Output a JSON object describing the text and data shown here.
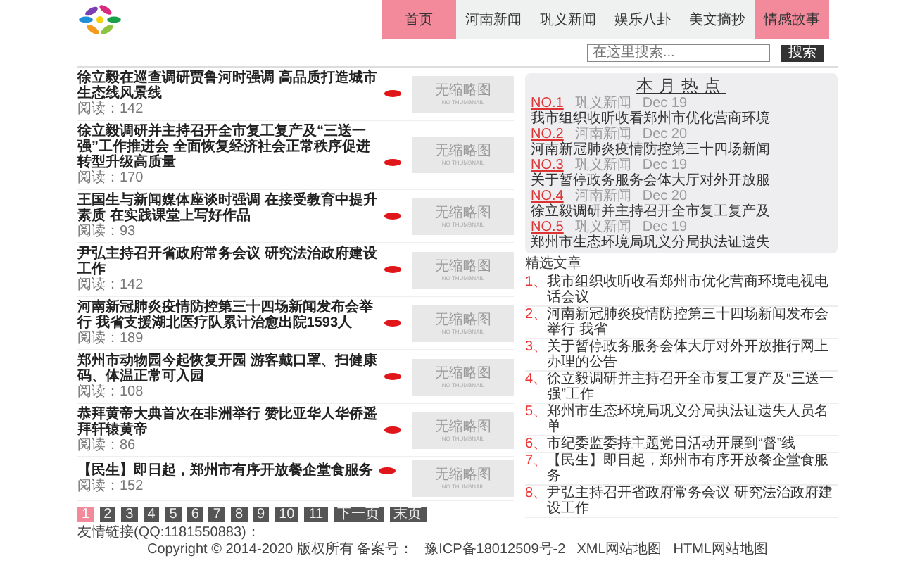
{
  "nav": [
    {
      "label": "首页",
      "selected": true
    },
    {
      "label": "河南新闻",
      "selected": false
    },
    {
      "label": "巩义新闻",
      "selected": false
    },
    {
      "label": "娱乐八卦",
      "selected": false
    },
    {
      "label": "美文摘抄",
      "selected": false
    },
    {
      "label": "情感故事",
      "selected": true
    }
  ],
  "search": {
    "placeholder": "在这里搜索...",
    "button": "搜索"
  },
  "articles": [
    {
      "title": "徐立毅在巡查调研贾鲁河时强调 高品质打造城市生态线风景线",
      "reads": "阅读：142",
      "thumbnail": {
        "text": "无缩略图",
        "subtext": "NO THUMBNAIL"
      }
    },
    {
      "title": "徐立毅调研并主持召开全市复工复产及“三送一强”工作推进会 全面恢复经济社会正常秩序促进转型升级高质量",
      "reads": "阅读：170",
      "thumbnail": {
        "text": "无缩略图",
        "subtext": "NO THUMBNAIL"
      }
    },
    {
      "title": "王国生与新闻媒体座谈时强调 在接受教育中提升素质 在实践课堂上写好作品",
      "reads": "阅读：93",
      "thumbnail": {
        "text": "无缩略图",
        "subtext": "NO THUMBNAIL"
      }
    },
    {
      "title": "尹弘主持召开省政府常务会议 研究法治政府建设工作",
      "reads": "阅读：142",
      "thumbnail": {
        "text": "无缩略图",
        "subtext": "NO THUMBNAIL"
      }
    },
    {
      "title": "河南新冠肺炎疫情防控第三十四场新闻发布会举行 我省支援湖北医疗队累计治愈出院1593人",
      "reads": "阅读：189",
      "thumbnail": {
        "text": "无缩略图",
        "subtext": "NO THUMBNAIL"
      }
    },
    {
      "title": "郑州市动物园今起恢复开园 游客戴口罩、扫健康码、体温正常可入园",
      "reads": "阅读：108",
      "thumbnail": {
        "text": "无缩略图",
        "subtext": "NO THUMBNAIL"
      }
    },
    {
      "title": "恭拜黄帝大典首次在非洲举行 赞比亚华人华侨遥拜轩辕黄帝",
      "reads": "阅读：86",
      "thumbnail": {
        "text": "无缩略图",
        "subtext": "NO THUMBNAIL"
      }
    },
    {
      "title": "【民生】即日起，郑州市有序开放餐企堂食服务",
      "reads": "阅读：152",
      "thumbnail": {
        "text": "无缩略图",
        "subtext": "NO THUMBNAIL"
      }
    }
  ],
  "pagination": [
    {
      "label": "1",
      "selected": true
    },
    {
      "label": "2",
      "selected": false
    },
    {
      "label": "3",
      "selected": false
    },
    {
      "label": "4",
      "selected": false
    },
    {
      "label": "5",
      "selected": false
    },
    {
      "label": "6",
      "selected": false
    },
    {
      "label": "7",
      "selected": false
    },
    {
      "label": "8",
      "selected": false
    },
    {
      "label": "9",
      "selected": false
    },
    {
      "label": "10",
      "selected": false
    },
    {
      "label": "11",
      "selected": false
    },
    {
      "label": "下一页",
      "selected": false
    },
    {
      "label": "末页",
      "selected": false
    }
  ],
  "hot": {
    "title": "本月热点",
    "items": [
      {
        "rank": "NO.1",
        "category": "巩义新闻",
        "date": "Dec 19",
        "title": "我市组织收听收看郑州市优化营商环境"
      },
      {
        "rank": "NO.2",
        "category": "河南新闻",
        "date": "Dec 20",
        "title": "河南新冠肺炎疫情防控第三十四场新闻"
      },
      {
        "rank": "NO.3",
        "category": "巩义新闻",
        "date": "Dec 19",
        "title": "关于暂停政务服务会体大厅对外开放服"
      },
      {
        "rank": "NO.4",
        "category": "河南新闻",
        "date": "Dec 20",
        "title": "徐立毅调研并主持召开全市复工复产及"
      },
      {
        "rank": "NO.5",
        "category": "巩义新闻",
        "date": "Dec 19",
        "title": "郑州市生态环境局巩义分局执法证遗失"
      }
    ]
  },
  "picks": {
    "title": "精选文章",
    "items": [
      {
        "number": "1、",
        "title": "我市组织收听收看郑州市优化营商环境电视电话会议"
      },
      {
        "number": "2、",
        "title": "河南新冠肺炎疫情防控第三十四场新闻发布会举行 我省"
      },
      {
        "number": "3、",
        "title": "关于暂停政务服务会体大厅对外开放推行网上办理的公告"
      },
      {
        "number": "4、",
        "title": "徐立毅调研并主持召开全市复工复产及“三送一强”工作"
      },
      {
        "number": "5、",
        "title": "郑州市生态环境局巩义分局执法证遗失人员名单"
      },
      {
        "number": "6、",
        "title": "市纪委监委持主题党日活动开展到“督”线"
      },
      {
        "number": "7、",
        "title": "【民生】即日起，郑州市有序开放餐企堂食服务"
      },
      {
        "number": "8、",
        "title": "尹弘主持召开省政府常务会议 研究法治政府建设工作"
      }
    ]
  },
  "friend_links": "友情链接(QQ:1181550883)：",
  "footer": {
    "copyright": "Copyright © 2014-2020 版权所有 备案号：",
    "links": [
      "豫ICP备18012509号-2",
      "XML网站地图",
      "HTML网站地图"
    ]
  }
}
